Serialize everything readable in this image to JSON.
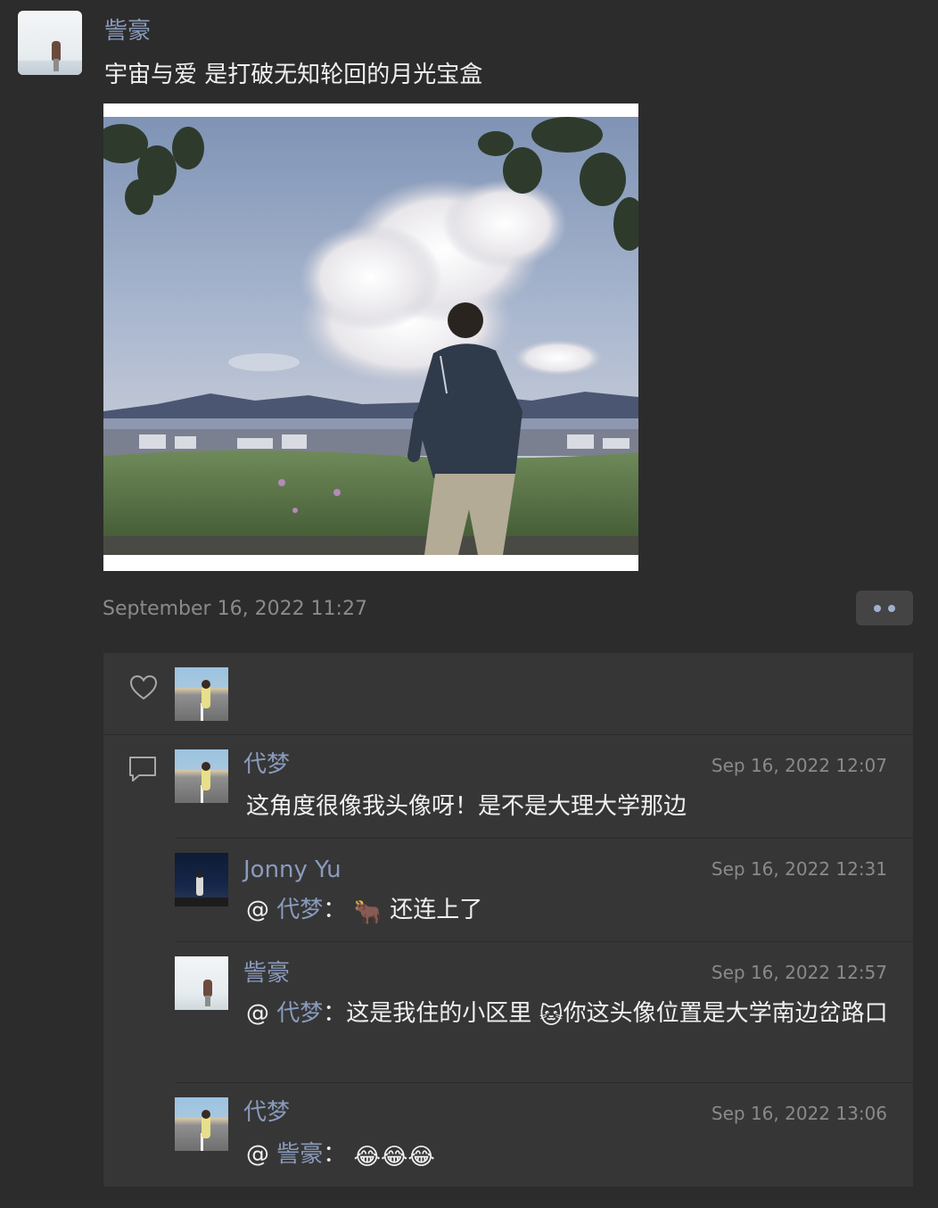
{
  "post": {
    "author": "訾豪",
    "text": "宇宙与爱 是打破无知轮回的月光宝盒",
    "time": "September 16, 2022 11:27"
  },
  "colors": {
    "background": "#2c2c2c",
    "panel": "#363636",
    "name_link": "#8a9bbd",
    "timestamp": "#8a8a8a"
  },
  "comments": [
    {
      "author": "代梦",
      "time": "Sep 16, 2022 12:07",
      "text": "这角度很像我头像呀！是不是大理大学那边"
    },
    {
      "author": "Jonny Yu",
      "time": "Sep 16, 2022 12:31",
      "at": "@",
      "mention": "代梦",
      "sep": "：",
      "emoji": "🐂",
      "text": " 还连上了"
    },
    {
      "author": "訾豪",
      "time": "Sep 16, 2022 12:57",
      "at": "@",
      "mention": "代梦",
      "sep": "：",
      "text_a": "这是我住的小区里 ",
      "emoji": "🐱",
      "text_b": "你这头像位置是大学南边岔路口"
    },
    {
      "author": "代梦",
      "time": "Sep 16, 2022 13:06",
      "at": "@",
      "mention": "訾豪",
      "sep": "：",
      "emoji": "😂😂😂"
    }
  ]
}
